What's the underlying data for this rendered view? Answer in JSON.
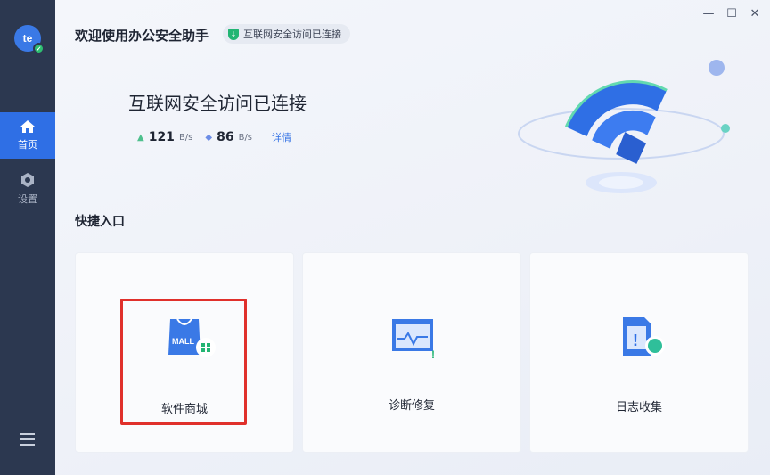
{
  "sidebar": {
    "avatar_text": "te",
    "items": [
      {
        "label": "首页",
        "icon": "home-icon",
        "active": true
      },
      {
        "label": "设置",
        "icon": "gear-icon",
        "active": false
      }
    ],
    "menu_icon": "hamburger-menu-icon"
  },
  "header": {
    "title": "欢迎使用办公安全助手",
    "status_text": "互联网安全访问已连接"
  },
  "window_controls": [
    "minimize",
    "maximize",
    "close"
  ],
  "hero": {
    "status_text": "互联网安全访问已连接",
    "upload_value": "121",
    "upload_unit": "B/s",
    "download_value": "86",
    "download_unit": "B/s",
    "detail_link": "详情"
  },
  "quick_access": {
    "title": "快捷入口",
    "cards": [
      {
        "label": "软件商城",
        "icon": "shopping-bag-icon",
        "icon_text": "MALL"
      },
      {
        "label": "诊断修复",
        "icon": "diagnostic-monitor-icon"
      },
      {
        "label": "日志收集",
        "icon": "log-file-icon"
      }
    ]
  },
  "colors": {
    "sidebar_bg": "#2c3850",
    "accent": "#2f6fe5",
    "success": "#22b573",
    "highlight": "#e0302b"
  }
}
